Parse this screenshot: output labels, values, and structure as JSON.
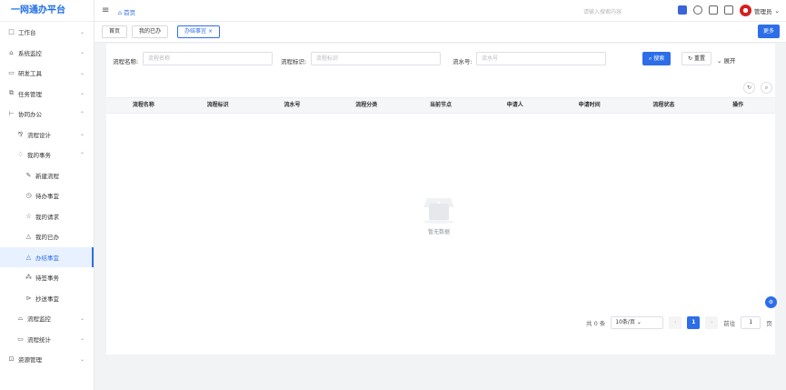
{
  "app": {
    "title": "一网通办平台"
  },
  "sidebar": {
    "items": [
      {
        "label": "工作台",
        "icon": "□",
        "level": 0,
        "arrow": "⌄"
      },
      {
        "label": "系统监控",
        "icon": "⌂",
        "level": 0,
        "arrow": "⌄"
      },
      {
        "label": "研发工具",
        "icon": "▭",
        "level": 0,
        "arrow": "⌄"
      },
      {
        "label": "任务管理",
        "icon": "⧉",
        "level": 0,
        "arrow": "⌄"
      },
      {
        "label": "协同办公",
        "icon": "⊢",
        "level": 0,
        "arrow": "⌃"
      },
      {
        "label": "流程设计",
        "icon": "⅋",
        "level": 1,
        "arrow": "⌄"
      },
      {
        "label": "我的事务",
        "icon": "♢",
        "level": 1,
        "arrow": "⌃"
      },
      {
        "label": "新建流程",
        "icon": "✎",
        "level": 2,
        "arrow": ""
      },
      {
        "label": "待办事宜",
        "icon": "◷",
        "level": 2,
        "arrow": ""
      },
      {
        "label": "我的请求",
        "icon": "☆",
        "level": 2,
        "arrow": ""
      },
      {
        "label": "我的已办",
        "icon": "△",
        "level": 2,
        "arrow": ""
      },
      {
        "label": "办结事宜",
        "icon": "△",
        "level": 2,
        "arrow": "",
        "active": true
      },
      {
        "label": "待签事务",
        "icon": "⁂",
        "level": 2,
        "arrow": ""
      },
      {
        "label": "抄送事宜",
        "icon": "⊳",
        "level": 2,
        "arrow": ""
      },
      {
        "label": "流程监控",
        "icon": "⌓",
        "level": 1,
        "arrow": "⌄"
      },
      {
        "label": "流程统计",
        "icon": "▭",
        "level": 1,
        "arrow": "⌄"
      },
      {
        "label": "资源管理",
        "icon": "⊡",
        "level": 0,
        "arrow": "⌄"
      }
    ]
  },
  "header": {
    "breadcrumb": "首页",
    "search_placeholder": "请输入搜索内容",
    "user": "管理员",
    "accent": "#2d6ee8"
  },
  "tags": {
    "items": [
      "首页",
      "我的已办",
      "办结事宜"
    ],
    "close": "×",
    "more": "更多"
  },
  "filters": {
    "name_label": "流程名称:",
    "name_placeholder": "流程名称",
    "key_label": "流程标识:",
    "key_placeholder": "流程标识",
    "serial_label": "流水号:",
    "serial_placeholder": "流水号",
    "search": "搜索",
    "reset": "重置",
    "expand": "展开"
  },
  "table": {
    "columns": [
      "流程名称",
      "流程标识",
      "流水号",
      "流程分类",
      "当前节点",
      "申请人",
      "申请时间",
      "流程状态",
      "操作"
    ],
    "empty_text": "暂无数据"
  },
  "pagination": {
    "total": "共 0 条",
    "page_size": "10条/页",
    "current_page": "1",
    "goto_label": "前往",
    "goto_value": "1",
    "goto_unit": "页"
  }
}
